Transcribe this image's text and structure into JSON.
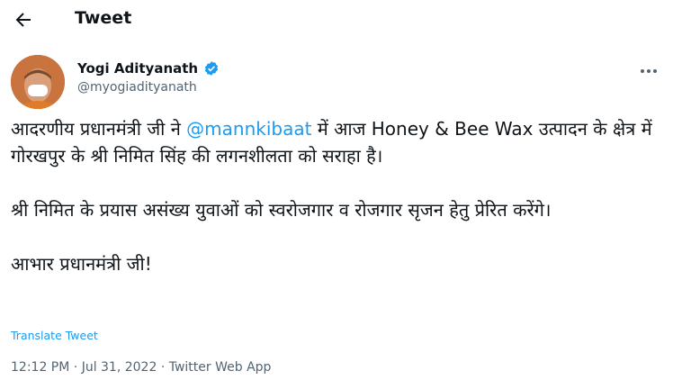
{
  "header": {
    "title": "Tweet"
  },
  "author": {
    "name": "Yogi Adityanath",
    "handle": "@myogiadityanath"
  },
  "tweet": {
    "p1_before": "आदरणीय प्रधानमंत्री जी ने ",
    "mention": "@mannkibaat",
    "p1_after": " में आज Honey & Bee Wax उत्पादन के क्षेत्र में गोरखपुर के श्री निमित सिंह की लगनशीलता को सराहा है।",
    "p2": "श्री निमित के प्रयास असंख्य युवाओं को स्वरोजगार व रोजगार सृजन हेतु प्रेरित करेंगे।",
    "p3": "आभार प्रधानमंत्री जी!",
    "translate_label": "Translate Tweet"
  },
  "meta": {
    "time": "12:12 PM",
    "date": "Jul 31, 2022",
    "source": "Twitter Web App"
  },
  "colors": {
    "accent": "#1d9bf0",
    "text": "#0f1419",
    "secondary": "#536471"
  },
  "icons": {
    "back": "arrow-left-icon",
    "verified": "verified-badge-icon",
    "more": "more-horizontal-icon"
  }
}
